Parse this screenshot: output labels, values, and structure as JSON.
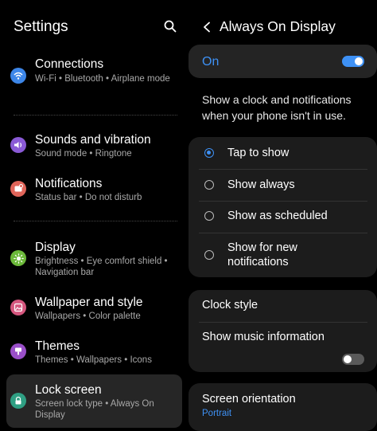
{
  "settings": {
    "title": "Settings",
    "search_icon": "search-icon",
    "items": [
      {
        "title": "Connections",
        "subtitle": "Wi-Fi  •  Bluetooth  •  Airplane mode",
        "icon": "wifi-icon",
        "color": "#3d86e8"
      },
      {
        "title": "Sounds and vibration",
        "subtitle": "Sound mode  •  Ringtone",
        "icon": "volume-icon",
        "color": "#8a5ad6"
      },
      {
        "title": "Notifications",
        "subtitle": "Status bar  •  Do not disturb",
        "icon": "notification-icon",
        "color": "#e0655a"
      },
      {
        "title": "Display",
        "subtitle": "Brightness  •  Eye comfort shield  •  Navigation bar",
        "icon": "brightness-icon",
        "color": "#6cb93a"
      },
      {
        "title": "Wallpaper and style",
        "subtitle": "Wallpapers  •  Color palette",
        "icon": "wallpaper-icon",
        "color": "#d5577e"
      },
      {
        "title": "Themes",
        "subtitle": "Themes  •  Wallpapers  •  Icons",
        "icon": "themes-icon",
        "color": "#9a4fc9"
      },
      {
        "title": "Lock screen",
        "subtitle": "Screen lock type  •  Always On Display",
        "icon": "lock-icon",
        "color": "#2f9f83"
      }
    ]
  },
  "aod": {
    "title": "Always On Display",
    "master_label": "On",
    "master_on": true,
    "description": "Show a clock and notifications when your phone isn't in use.",
    "options": [
      {
        "label": "Tap to show",
        "selected": true
      },
      {
        "label": "Show always",
        "selected": false
      },
      {
        "label": "Show as scheduled",
        "selected": false
      },
      {
        "label": "Show for new notifications",
        "selected": false
      }
    ],
    "clock_style": "Clock style",
    "music_info": "Show music information",
    "music_on": false,
    "orientation_label": "Screen orientation",
    "orientation_value": "Portrait"
  },
  "colors": {
    "accent": "#3e91f5"
  }
}
